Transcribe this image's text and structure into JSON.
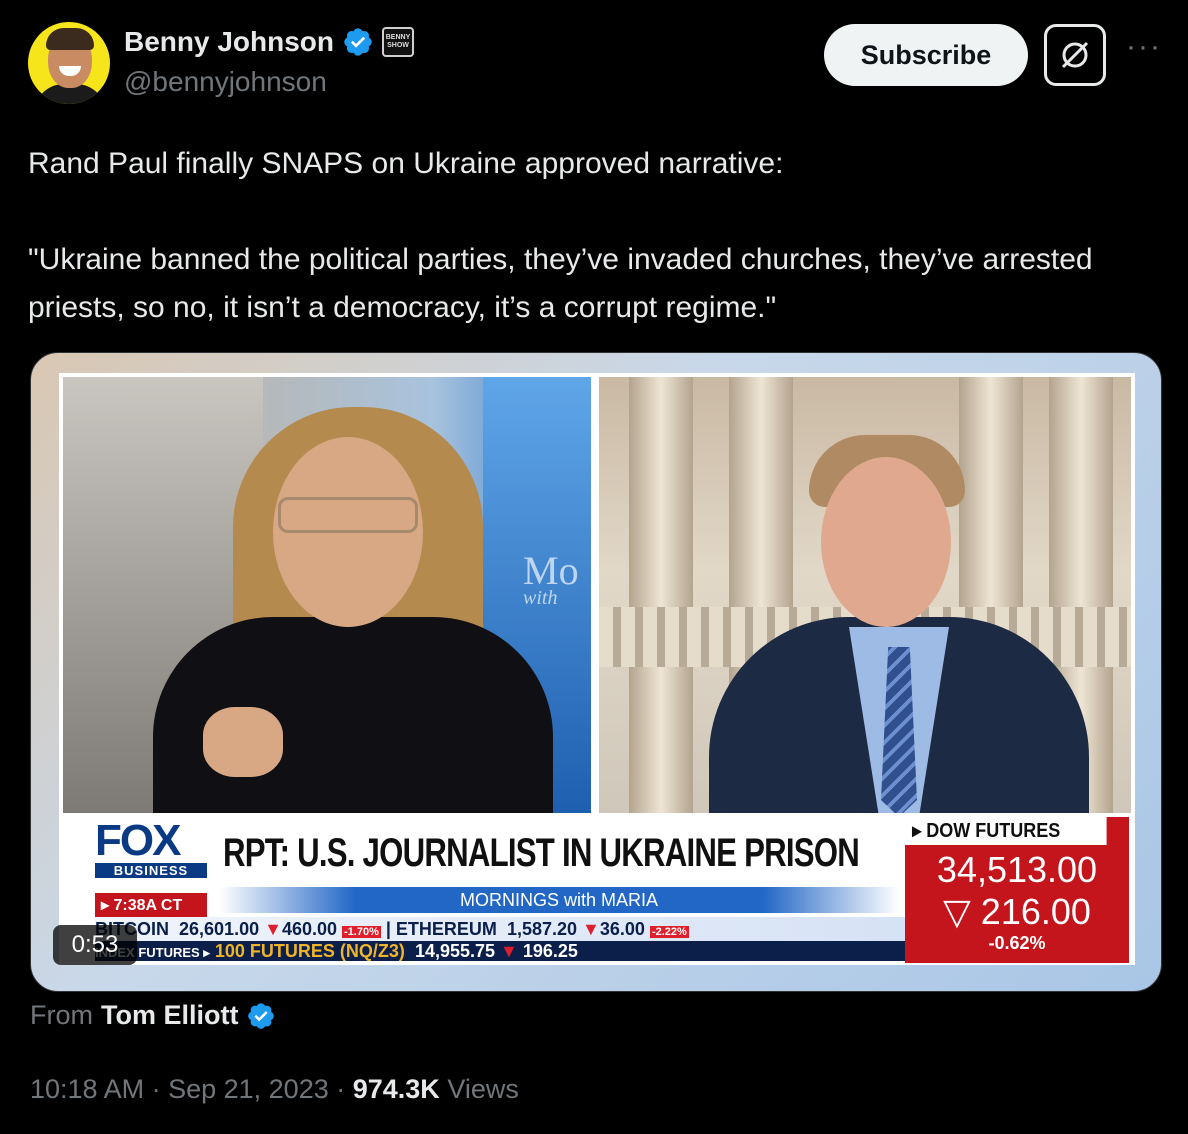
{
  "author": {
    "name": "Benny Johnson",
    "handle": "@bennyjohnson",
    "badge_text": "BENNY SHOW"
  },
  "actions": {
    "subscribe_label": "Subscribe",
    "more_label": "···"
  },
  "tweet": {
    "line1": "Rand Paul finally SNAPS on Ukraine approved narrative:",
    "quote": "\"Ukraine banned the political parties, they’ve invaded churches, they’ve arrested priests, so no, it isn’t a democracy, it’s a corrupt regime.\""
  },
  "video": {
    "duration": "0:53",
    "studio_mark_1": "Mo",
    "studio_mark_2": "with",
    "network_logo": "FOX",
    "network_sub": "BUSINESS",
    "time": "▸ 7:38A CT",
    "headline": "RPT: U.S. JOURNALIST IN UKRAINE PRISON",
    "show_name": "MORNINGS with MARIA",
    "ticker_row1": {
      "item1": "BITCOIN",
      "value1": "26,601.00",
      "change1": "460.00",
      "pct1": "-1.70%",
      "item2": "ETHEREUM",
      "value2": "1,587.20",
      "change2": "36.00",
      "pct2": "-2.22%"
    },
    "ticker_row2": {
      "label": "INDEX FUTURES ▸",
      "item": "100 FUTURES (NQ/Z3)",
      "value": "14,955.75",
      "change": "196.25"
    },
    "dow": {
      "label": "▸ DOW FUTURES",
      "value": "34,513.00",
      "change": "216.00",
      "pct": "-0.62%"
    }
  },
  "source": {
    "prefix": "From",
    "name": "Tom Elliott"
  },
  "meta": {
    "time": "10:18 AM",
    "date": "Sep 21, 2023",
    "views_count": "974.3K",
    "views_label": "Views"
  },
  "colors": {
    "background": "#000000",
    "text": "#e7e9ea",
    "secondary": "#71767b",
    "verified": "#1d9bf0"
  }
}
